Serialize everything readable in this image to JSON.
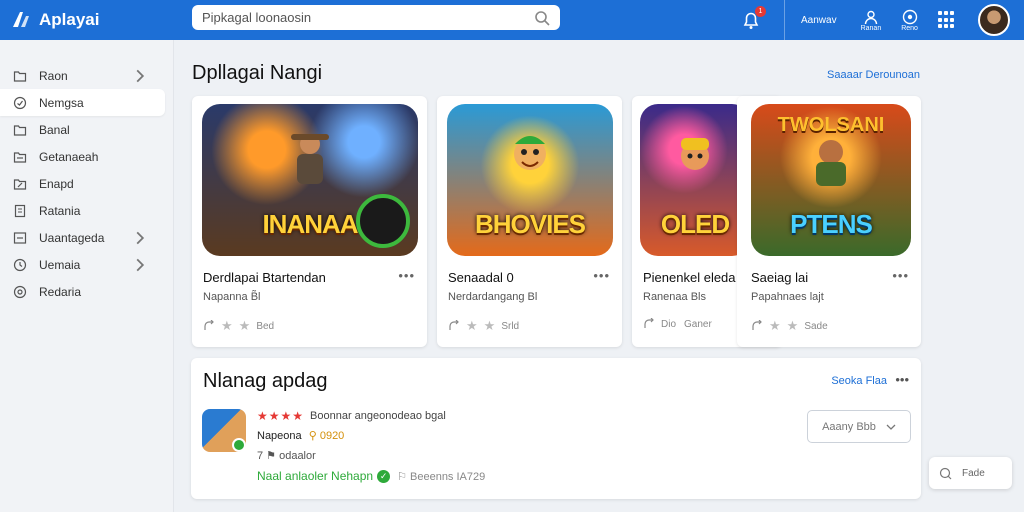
{
  "brand": {
    "name": "Aplayai"
  },
  "search": {
    "placeholder": "Pipkagal loonaosin"
  },
  "topbar": {
    "notification_count": "1",
    "link_label": "Aanwav",
    "icon1_label": "Ranan",
    "icon2_label": "Reno"
  },
  "sidebar": {
    "items": [
      {
        "label": "Raon",
        "icon": "folder-icon",
        "chevron": true
      },
      {
        "label": "Nemgsa",
        "icon": "compass-icon",
        "chevron": false
      },
      {
        "label": "Banal",
        "icon": "folder-icon",
        "chevron": false
      },
      {
        "label": "Getanaeah",
        "icon": "folder-icon",
        "chevron": false
      },
      {
        "label": "Enapd",
        "icon": "folder-icon",
        "chevron": false
      },
      {
        "label": "Ratania",
        "icon": "document-icon",
        "chevron": false
      },
      {
        "label": "Uaantageda",
        "icon": "list-icon",
        "chevron": true
      },
      {
        "label": "Uemaia",
        "icon": "clock-icon",
        "chevron": true
      },
      {
        "label": "Redaria",
        "icon": "globe-icon",
        "chevron": false
      }
    ]
  },
  "section": {
    "title": "Dpllagai Nangi",
    "link": "Saaaar Derounoan"
  },
  "cards": [
    {
      "thumb_text": "INANAA",
      "title": "Derdlapai Btartendan",
      "subtitle": "Napanna B̃l",
      "foot": "Bed"
    },
    {
      "thumb_text": "BHOVIES",
      "title": "Senaadal 0",
      "subtitle": "Nerdardangang Bl",
      "foot": "Srld"
    },
    {
      "thumb_text": "OLED",
      "title": "Pienenkel eleda",
      "subtitle": "Ranenaa Bls",
      "foot": "Dio",
      "foot2": "Ganer"
    },
    {
      "thumb_text": "PTENS",
      "thumb_top": "TWOLSANI",
      "title": "Saeiag lai",
      "subtitle": "Papahnaes lajt",
      "foot": "Sade"
    }
  ],
  "panel": {
    "title": "Nlanag apdag",
    "link": "Seoka Flaa",
    "review": {
      "stars": "★★★★",
      "summary": "Boonnar angeonodeao bgal",
      "name": "Napeona",
      "tag": "⚲ 0920",
      "line3": "7 ⚑ odaalor",
      "status": "Naal anlaoler Nehapn",
      "meta": "⚐ Beeenns IA729"
    },
    "dropdown_label": "Aaany Bbb"
  },
  "float_button": {
    "label": "Fade"
  },
  "colors": {
    "accent": "#1d6fd6",
    "star": "#e53935",
    "success": "#2eaa3a"
  }
}
